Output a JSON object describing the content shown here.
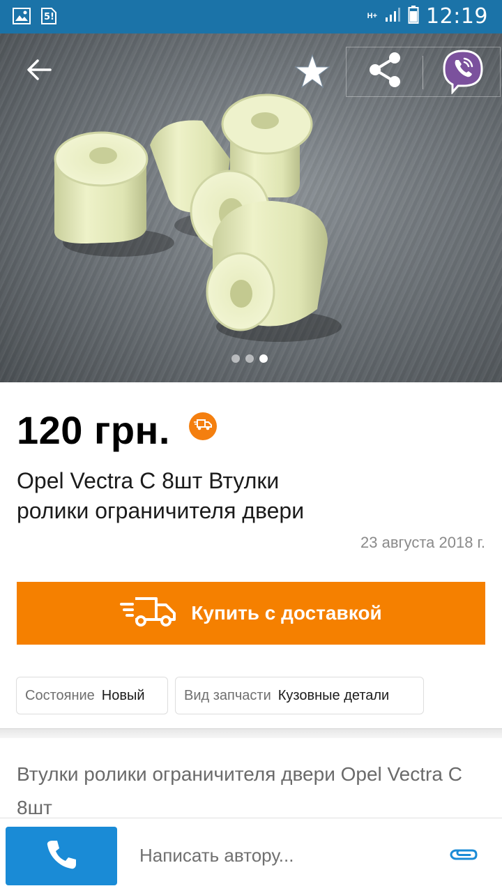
{
  "status_bar": {
    "time": "12:19",
    "network": "H+",
    "sim_indicator": "5!",
    "icons": [
      "gallery-icon",
      "sim-icon",
      "network-icon",
      "signal-icon",
      "battery-icon"
    ],
    "bg_color": "#1b73a8"
  },
  "hero": {
    "image_description_icon": "product-photo",
    "slide_count": 3,
    "active_slide": 3,
    "actions": [
      "back-arrow-icon",
      "star-icon",
      "share-icon",
      "viber-icon"
    ]
  },
  "listing": {
    "price": "120 грн.",
    "title": "Opel Vectra C 8шт Втулки ролики ограничителя двери",
    "date": "23 августа 2018 г.",
    "delivery_badge_icon": "truck-icon"
  },
  "buy_button": {
    "label": "Купить с доставкой",
    "icon": "delivery-truck-icon",
    "color": "#f58000"
  },
  "params": [
    {
      "key": "Состояние",
      "value": "Новый"
    },
    {
      "key": "Вид запчасти",
      "value": "Кузовные детали"
    }
  ],
  "description": "Втулки ролики ограничителя двери Opel Vectra C 8шт",
  "bottom_bar": {
    "call_icon": "phone-icon",
    "message_placeholder": "Написать автору...",
    "attach_icon": "paperclip-icon",
    "call_color": "#1a8bd6"
  }
}
